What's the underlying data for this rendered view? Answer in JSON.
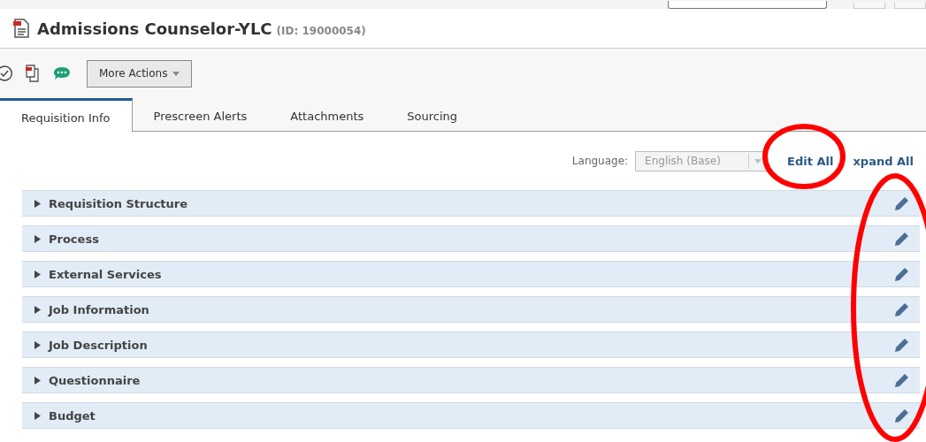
{
  "header": {
    "title": "Admissions Counselor-YLC",
    "id_text": "(ID: 19000054)"
  },
  "toolbar": {
    "more_actions": "More Actions"
  },
  "tabs": [
    {
      "label": "Requisition Info",
      "selected": true
    },
    {
      "label": "Prescreen Alerts",
      "selected": false
    },
    {
      "label": "Attachments",
      "selected": false
    },
    {
      "label": "Sourcing",
      "selected": false
    }
  ],
  "language": {
    "label": "Language:",
    "value": "English (Base)",
    "disabled": true
  },
  "links": {
    "edit_all": "Edit All",
    "expand_all": "xpand All"
  },
  "sections": [
    {
      "title": "Requisition Structure",
      "expanded": false
    },
    {
      "title": "Process",
      "expanded": false
    },
    {
      "title": "External Services",
      "expanded": false
    },
    {
      "title": "Job Information",
      "expanded": false
    },
    {
      "title": "Job Description",
      "expanded": false
    },
    {
      "title": "Questionnaire",
      "expanded": false
    },
    {
      "title": "Budget",
      "expanded": false
    }
  ],
  "annotations": [
    {
      "kind": "ellipse"
    },
    {
      "kind": "ellipse"
    }
  ]
}
